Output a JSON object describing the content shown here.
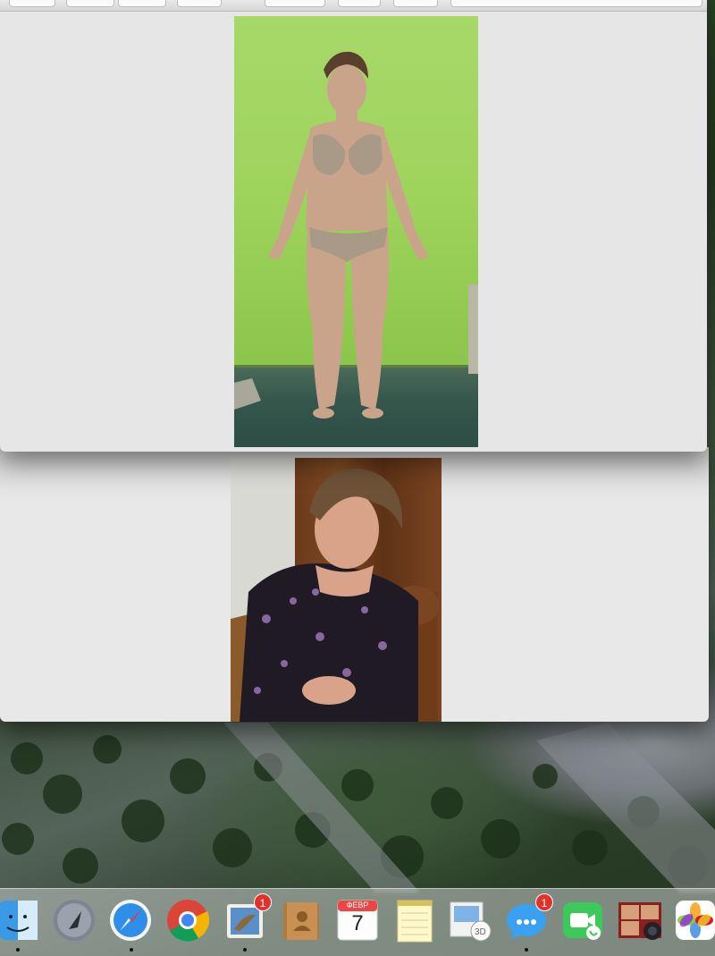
{
  "desktop": {
    "wallpaper": "mountain-forest"
  },
  "viewer_front": {
    "image_name": "standing-woman-photo"
  },
  "viewer_back": {
    "image_name": "seated-woman-photo"
  },
  "dock": {
    "items": [
      {
        "name": "finder-icon",
        "running": true
      },
      {
        "name": "launchpad-icon",
        "running": false
      },
      {
        "name": "safari-icon",
        "running": true
      },
      {
        "name": "chrome-icon",
        "running": false
      },
      {
        "name": "mail-icon",
        "running": true,
        "badge": "1"
      },
      {
        "name": "contacts-icon",
        "running": false
      },
      {
        "name": "calendar-icon",
        "running": false,
        "month": "ФЕВР",
        "day": "7"
      },
      {
        "name": "notes-icon",
        "running": false
      },
      {
        "name": "preview-icon",
        "running": false
      },
      {
        "name": "messages-icon",
        "running": true,
        "badge": "1"
      },
      {
        "name": "facetime-icon",
        "running": false
      },
      {
        "name": "photo-booth-icon",
        "running": false
      },
      {
        "name": "photos-icon",
        "running": false
      }
    ]
  },
  "colors": {
    "green_wall": "#9fd45c",
    "badge_red": "#e0322b",
    "window_bg": "#e6e6e6"
  }
}
